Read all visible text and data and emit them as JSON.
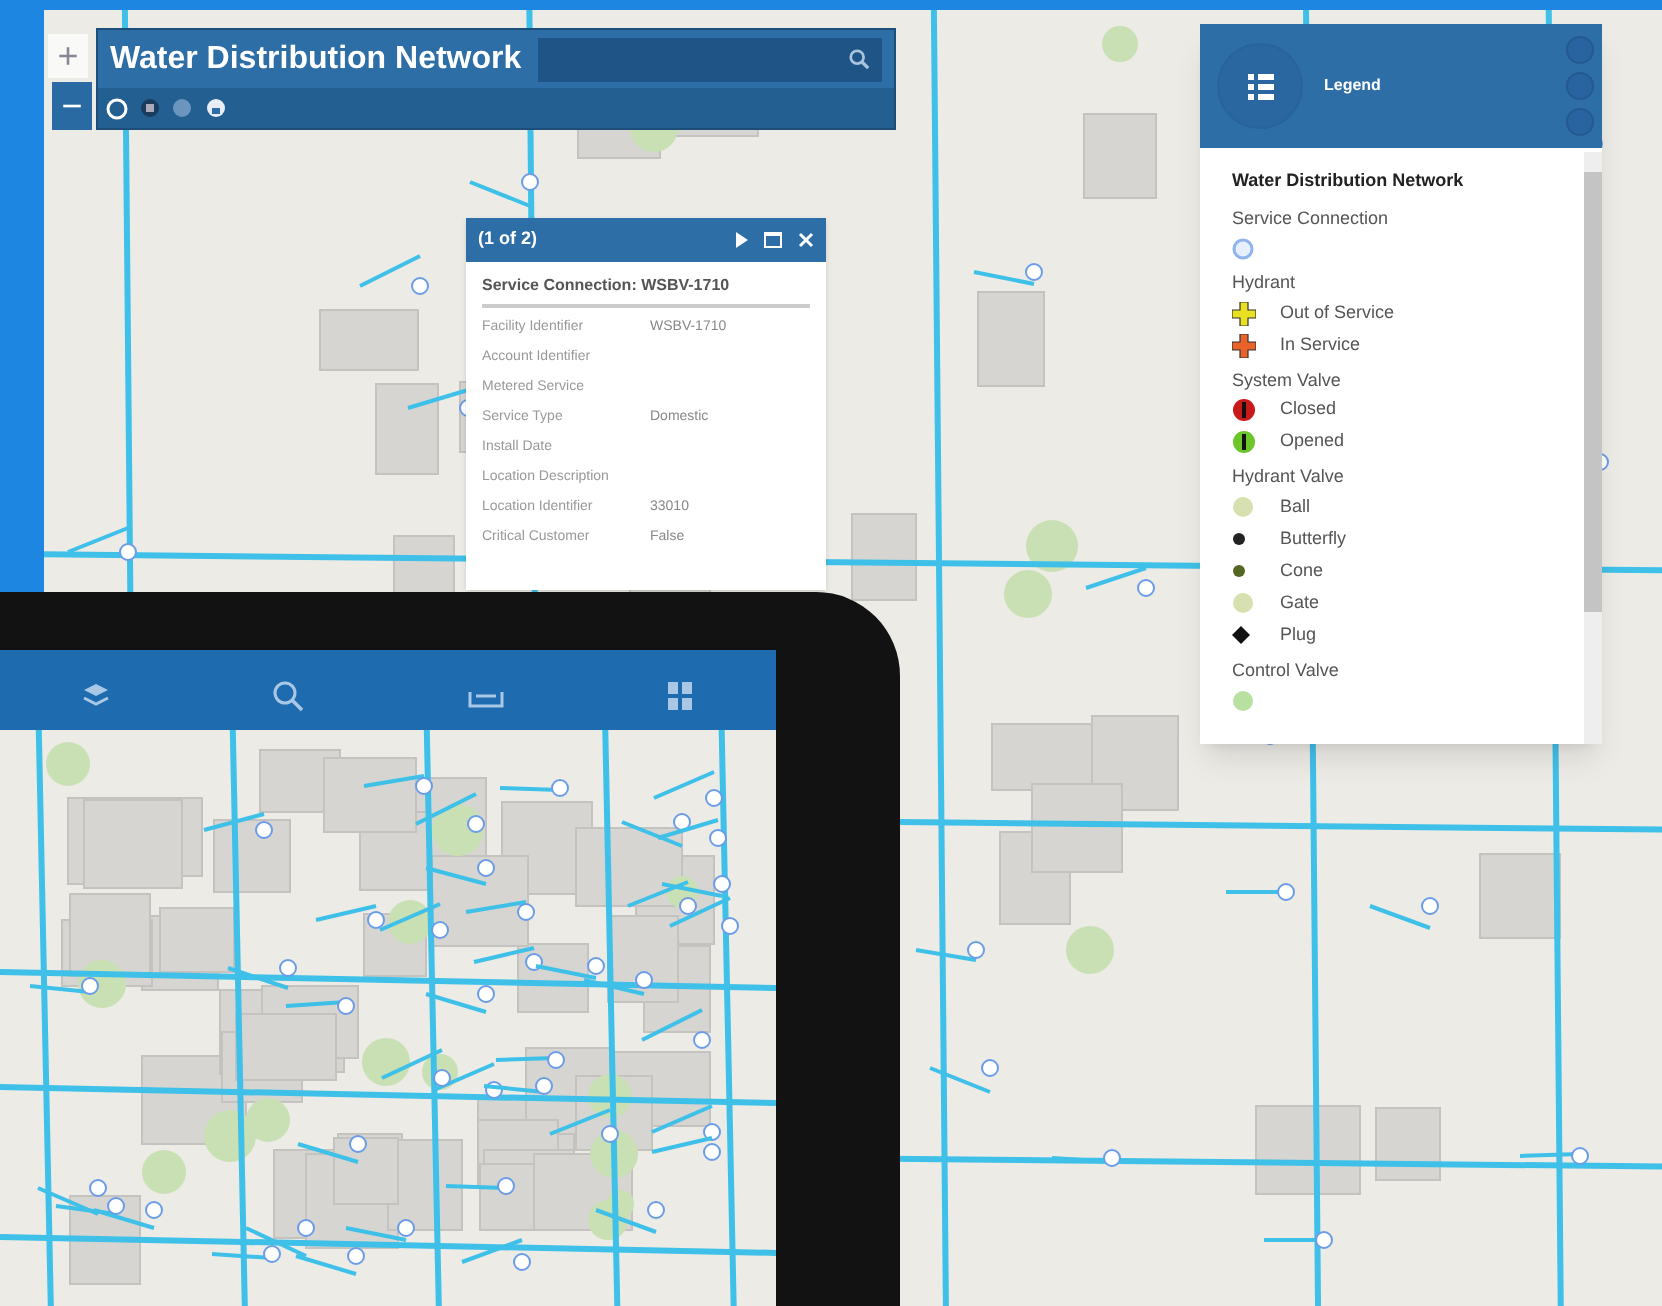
{
  "app": {
    "title": "Water Distribution Network",
    "zoom_in": "+",
    "zoom_out": "−"
  },
  "popup": {
    "pager": "(1 of 2)",
    "title": "Service Connection: WSBV-1710",
    "fields": [
      {
        "label": "Facility Identifier",
        "value": "WSBV-1710"
      },
      {
        "label": "Account Identifier"
      },
      {
        "label": "Metered Service"
      },
      {
        "label": "Service Type",
        "value": "Domestic"
      },
      {
        "label": "Install Date"
      },
      {
        "label": "Location Description"
      },
      {
        "label": "Location Identifier",
        "value": "33010"
      },
      {
        "label": "Critical Customer",
        "value": "False"
      }
    ]
  },
  "legend": {
    "title": "Legend",
    "layer": "Water Distribution Network",
    "groups": [
      {
        "name": "Service Connection",
        "items": [
          {
            "kind": "service",
            "color": "#8fb4f0"
          }
        ]
      },
      {
        "name": "Hydrant",
        "items": [
          {
            "kind": "hydrant",
            "label": "Out of Service",
            "color": "#e8e020"
          },
          {
            "kind": "hydrant",
            "label": "In Service",
            "color": "#e8622a"
          }
        ]
      },
      {
        "name": "System Valve",
        "items": [
          {
            "kind": "valve",
            "label": "Closed",
            "color": "#c81a1a"
          },
          {
            "kind": "valve",
            "label": "Opened",
            "color": "#6cc62a"
          }
        ]
      },
      {
        "name": "Hydrant Valve",
        "items": [
          {
            "kind": "dot",
            "label": "Ball",
            "color": "#d6e0b0"
          },
          {
            "kind": "small",
            "label": "Butterfly",
            "color": "#222222"
          },
          {
            "kind": "small",
            "label": "Cone",
            "color": "#556622"
          },
          {
            "kind": "dot",
            "label": "Gate",
            "color": "#d6e0b0"
          },
          {
            "kind": "plug",
            "label": "Plug",
            "color": "#111111"
          }
        ]
      },
      {
        "name": "Control Valve",
        "items": [
          {
            "kind": "dot",
            "color": "#b8e0a0"
          }
        ]
      }
    ]
  }
}
